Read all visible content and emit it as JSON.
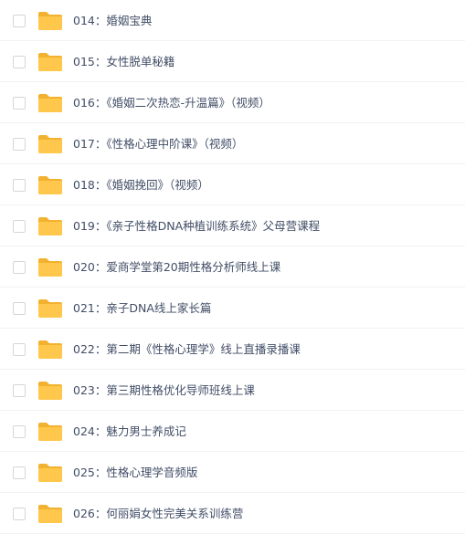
{
  "file_list": {
    "items": [
      {
        "name": "014：婚姻宝典",
        "icon": "folder-icon"
      },
      {
        "name": "015：女性脱单秘籍",
        "icon": "folder-icon"
      },
      {
        "name": "016：《婚姻二次热恋-升温篇》（视频）",
        "icon": "folder-icon"
      },
      {
        "name": "017：《性格心理中阶课》（视频）",
        "icon": "folder-icon"
      },
      {
        "name": "018：《婚姻挽回》（视频）",
        "icon": "folder-icon"
      },
      {
        "name": "019：《亲子性格DNA种植训练系统》父母营课程",
        "icon": "folder-icon"
      },
      {
        "name": "020：爱商学堂第20期性格分析师线上课",
        "icon": "folder-icon"
      },
      {
        "name": "021：亲子DNA线上家长篇",
        "icon": "folder-icon"
      },
      {
        "name": "022：第二期《性格心理学》线上直播录播课",
        "icon": "folder-icon"
      },
      {
        "name": "023：第三期性格优化导师班线上课",
        "icon": "folder-icon"
      },
      {
        "name": "024：魅力男士养成记",
        "icon": "folder-icon"
      },
      {
        "name": "025：性格心理学音频版",
        "icon": "folder-icon"
      },
      {
        "name": "026：何丽娟女性完美关系训练营",
        "icon": "folder-icon"
      }
    ]
  },
  "colors": {
    "folder_body": "#ffc84c",
    "folder_tab": "#f2b12e",
    "text": "#424e67",
    "checkbox_border": "#d3d6db",
    "row_divider": "#f1f2f4"
  }
}
